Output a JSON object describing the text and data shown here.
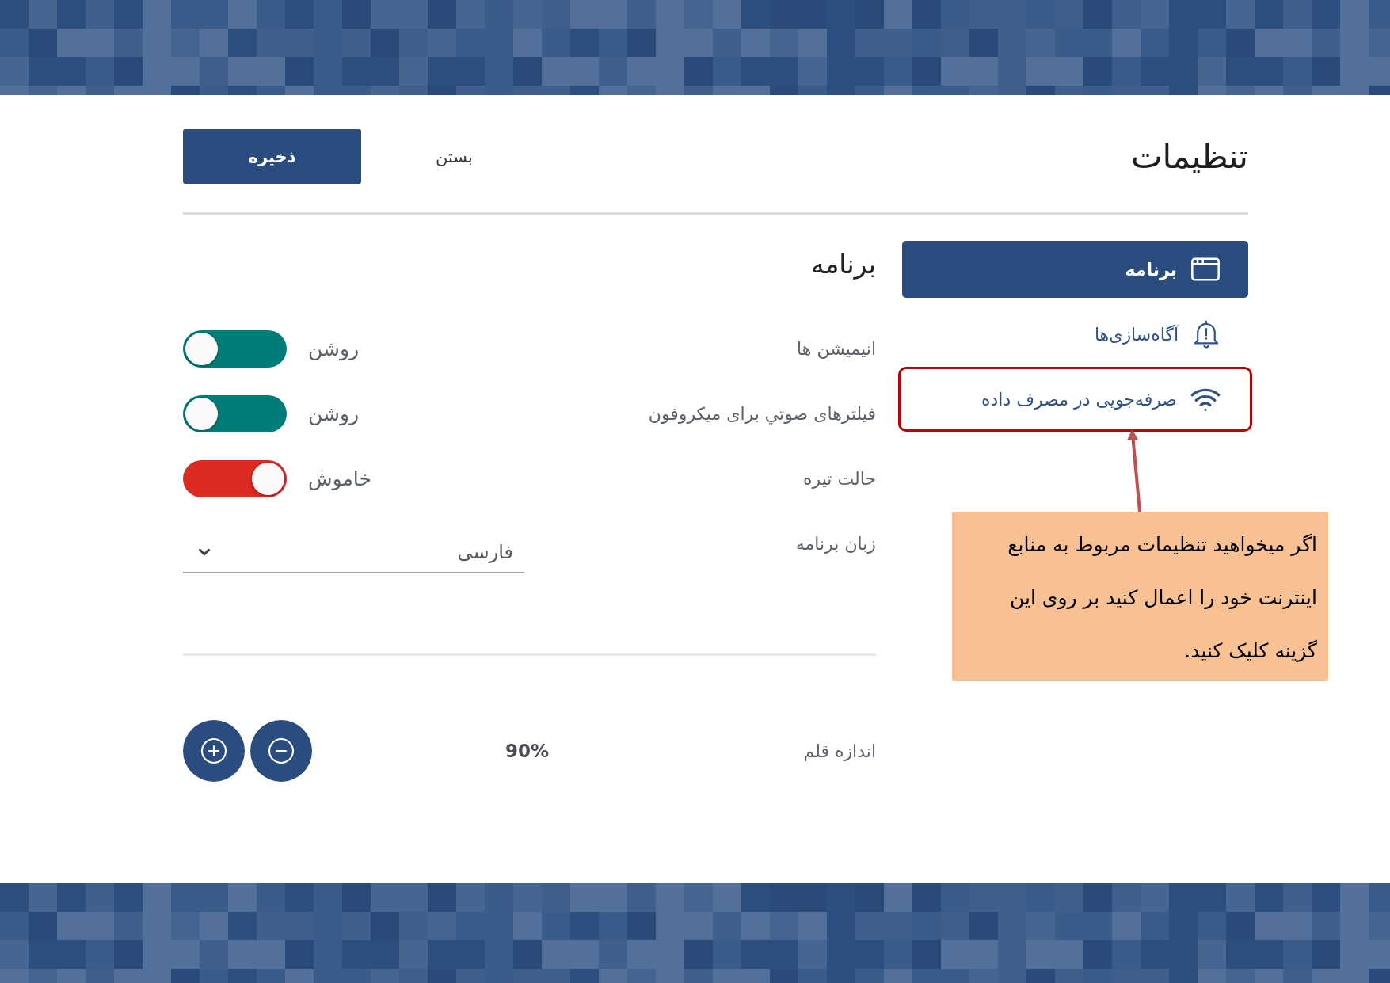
{
  "header": {
    "title": "تنظیمات",
    "buttons": [
      {
        "label": "بستن",
        "kind": "text"
      },
      {
        "label": "ذخیره",
        "kind": "primary"
      }
    ]
  },
  "sidebar": {
    "items": [
      {
        "label": "برنامه",
        "selected": true,
        "annotated": false
      },
      {
        "label": "آگاه‌سازی‌ها",
        "selected": false,
        "annotated": false
      },
      {
        "label": "صرفه‌جویی در مصرف داده",
        "selected": false,
        "annotated": true
      }
    ]
  },
  "content": {
    "heading": "برنامه",
    "settings": [
      {
        "kind": "toggle",
        "label": "انیمیشن ها",
        "on": true,
        "state_label": "روشن"
      },
      {
        "kind": "toggle",
        "label": "فیلترهای صوتي برای میکروفون",
        "on": true,
        "state_label": "روشن"
      },
      {
        "kind": "toggle",
        "label": "حالت تیره",
        "on": false,
        "state_label": "خاموش"
      },
      {
        "kind": "select",
        "label": "زبان برنامه",
        "value": "فارسی"
      }
    ],
    "font_size": {
      "label": "اندازه قلم",
      "value": "90%"
    }
  },
  "callout": {
    "text": "اگر میخواهید تنظیمات مربوط به منابع اینترنت خود را اعمال کنید بر روی این گزینه کلیک کنید."
  }
}
